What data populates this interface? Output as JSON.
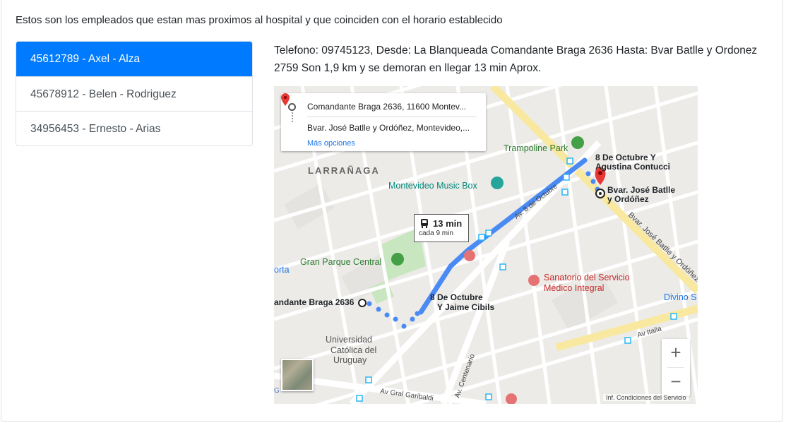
{
  "intro_text": "Estos son los empleados que estan mas proximos al hospital y que coinciden con el horario establecido",
  "employees": [
    {
      "label": "45612789 - Axel - Alza",
      "active": true
    },
    {
      "label": "45678912 - Belen - Rodriguez",
      "active": false
    },
    {
      "label": "34956453 - Ernesto - Arias",
      "active": false
    }
  ],
  "detail_text": "Telefono: 09745123, Desde: La Blanqueada Comandante Braga 2636 Hasta: Bvar Batlle y Ordonez 2759 Son 1,9 km y se demoran en llegar 13 min Aprox.",
  "map": {
    "origin": "Comandante Braga 2636, 11600 Montev...",
    "destination": "Bvar. José Batlle y Ordóñez, Montevideo,...",
    "more_options": "Más opciones",
    "transit_time": "13 min",
    "transit_freq": "cada 9 min",
    "labels": {
      "larranaga": "LARRAÑAGA",
      "trampoline": "Trampoline Park",
      "music_box": "Montevideo Music Box",
      "parque": "Gran Parque Central",
      "sanatorio_1": "Sanatorio del Servicio",
      "sanatorio_2": "Médico Integral",
      "universidad_1": "Universidad",
      "universidad_2": "Católica del",
      "universidad_3": "Uruguay",
      "stop_1a": "8 De Octubre Y",
      "stop_1b": "Agustina Contucci",
      "dest_a": "Bvar. José Batlle",
      "dest_b": "y Ordóñez",
      "stop_2a": "8 De Octubre",
      "stop_2b": "Y Jaime Cibils",
      "origin_label": "andante Braga 2636",
      "divino": "Divino S",
      "orta": "orta",
      "av_italia": "Av Italia",
      "av_8_oct": "Av. 8 de Octubre",
      "bvar": "Bvar. José Batlle y Ordóñez",
      "av_centenario": "Av. Centenario",
      "av_garibaldi": "Av Gral Garibaldi"
    },
    "zoom_in": "+",
    "zoom_out": "−",
    "footer": "Inf. Condiciones del Servicio",
    "google": "G"
  }
}
